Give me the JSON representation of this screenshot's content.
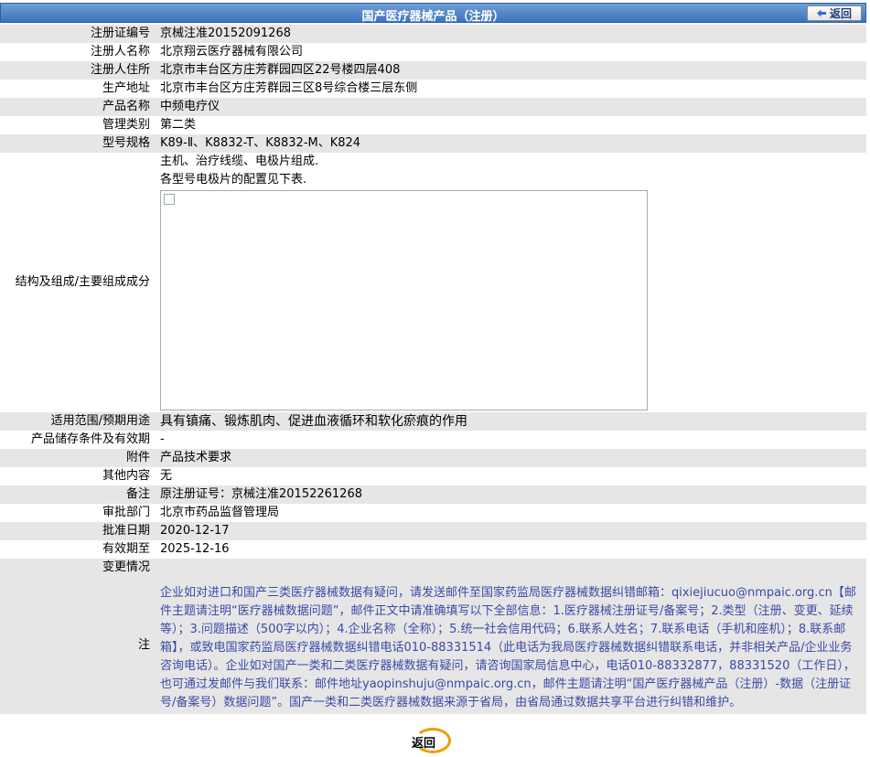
{
  "header": {
    "title": "国产医疗器械产品（注册）",
    "back_label": "返回"
  },
  "rows": {
    "reg_no": {
      "label": "注册证编号",
      "value": "京械注准20152091268"
    },
    "registrant": {
      "label": "注册人名称",
      "value": "北京翔云医疗器械有限公司"
    },
    "address": {
      "label": "注册人住所",
      "value": "北京市丰台区方庄芳群园四区22号楼四层408"
    },
    "production": {
      "label": "生产地址",
      "value": "北京市丰台区方庄芳群园三区8号综合楼三层东侧"
    },
    "product": {
      "label": "产品名称",
      "value": "中频电疗仪"
    },
    "category": {
      "label": "管理类别",
      "value": "第二类"
    },
    "models": {
      "label": "型号规格",
      "value": "K89-Ⅱ、K8832-T、K8832-M、K824"
    },
    "structure": {
      "label": "结构及组成/主要组成成分",
      "line1": "主机、治疗线缆、电极片组成.",
      "line2": "各型号电极片的配置见下表."
    },
    "usage": {
      "label": "适用范围/预期用途",
      "value": "具有镇痛、锻炼肌肉、促进血液循环和软化瘀痕的作用"
    },
    "storage": {
      "label": "产品储存条件及有效期",
      "value": "-"
    },
    "attachment": {
      "label": "附件",
      "value": "产品技术要求"
    },
    "other": {
      "label": "其他内容",
      "value": "无"
    },
    "remark": {
      "label": "备注",
      "value": "原注册证号：京械注准20152261268"
    },
    "dept": {
      "label": "审批部门",
      "value": "北京市药品监督管理局"
    },
    "approve_date": {
      "label": "批准日期",
      "value": "2020-12-17"
    },
    "expiry": {
      "label": "有效期至",
      "value": "2025-12-16"
    },
    "changes": {
      "label": "变更情况",
      "value": ""
    },
    "note": {
      "label": "注",
      "value": "企业如对进口和国产三类医疗器械数据有疑问，请发送邮件至国家药监局医疗器械数据纠错邮箱：qixiejiucuo@nmpaic.org.cn【邮件主题请注明“医疗器械数据问题”，邮件正文中请准确填写以下全部信息：1.医疗器械注册证号/备案号；2.类型（注册、变更、延续等）；3.问题描述（500字以内）；4.企业名称（全称）；5.统一社会信用代码；6.联系人姓名；7.联系电话（手机和座机）；8.联系邮箱】，或致电国家药监局医疗器械数据纠错电话010-88331514（此电话为我局医疗器械数据纠错联系电话，并非相关产品/企业业务咨询电话）。企业如对国产一类和二类医疗器械数据有疑问，请咨询国家局信息中心，电话010-88332877，88331520（工作日），也可通过发邮件与我们联系：邮件地址yaopinshuju@nmpaic.org.cn，邮件主题请注明“国产医疗器械产品（注册）-数据（注册证号/备案号）数据问题”。国产一类和二类医疗器械数据来源于省局，由省局通过数据共享平台进行纠错和维护。"
    }
  },
  "footer": {
    "back_label": "返回"
  },
  "colors": {
    "header": "#4a7fc4",
    "row_alt": "#e6e6e6",
    "note_text": "#3b4aa6",
    "ring": "#e8a000"
  }
}
